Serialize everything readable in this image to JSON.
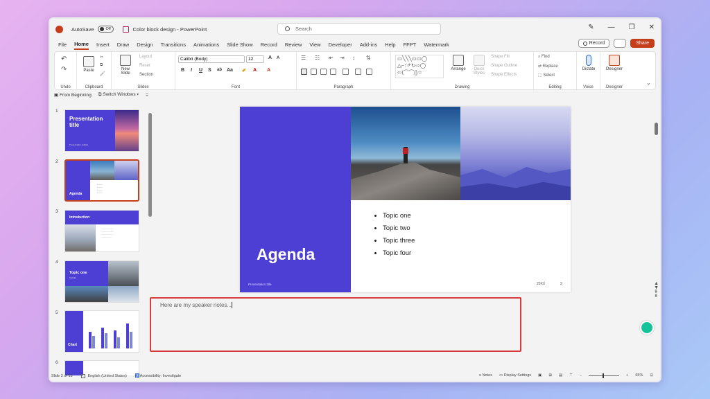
{
  "titlebar": {
    "autosave": "AutoSave",
    "toggle": "Off",
    "doc_title": "Color block design",
    "app": "PowerPoint",
    "search_placeholder": "Search"
  },
  "menu": {
    "items": [
      "File",
      "Home",
      "Insert",
      "Draw",
      "Design",
      "Transitions",
      "Animations",
      "Slide Show",
      "Record",
      "Review",
      "View",
      "Developer",
      "Add-ins",
      "Help",
      "FFPT",
      "Watermark"
    ],
    "active": "Home",
    "record": "Record",
    "share": "Share"
  },
  "ribbon": {
    "undo": "Undo",
    "clipboard": {
      "paste": "Paste",
      "label": "Clipboard"
    },
    "slides": {
      "new_slide": "New Slide",
      "layout": "Layout",
      "reset": "Reset",
      "section": "Section",
      "label": "Slides"
    },
    "font": {
      "name": "Calibri (Body)",
      "size": "12",
      "label": "Font"
    },
    "paragraph": {
      "label": "Paragraph"
    },
    "drawing": {
      "arrange": "Arrange",
      "quick_styles": "Quick Styles",
      "shape_fill": "Shape Fill",
      "shape_outline": "Shape Outline",
      "shape_effects": "Shape Effects",
      "label": "Drawing"
    },
    "editing": {
      "find": "Find",
      "replace": "Replace",
      "select": "Select",
      "label": "Editing"
    },
    "voice": {
      "dictate": "Dictate",
      "label": "Voice"
    },
    "designer": {
      "designer": "Designer",
      "label": "Designer"
    }
  },
  "quickbar": {
    "from_beginning": "From Beginning",
    "switch_windows": "Switch Windows"
  },
  "thumbnails": [
    {
      "num": "1",
      "title": "Presentation title",
      "sub": "Presentation subtitle"
    },
    {
      "num": "2",
      "title": "Agenda"
    },
    {
      "num": "3",
      "title": "Introduction"
    },
    {
      "num": "4",
      "title": "Topic one",
      "sub": "Subtitle"
    },
    {
      "num": "5",
      "title": "Chart"
    },
    {
      "num": "6"
    }
  ],
  "slide": {
    "title": "Agenda",
    "bullets": [
      "Topic one",
      "Topic two",
      "Topic three",
      "Topic four"
    ],
    "footer_left": "Presentation title",
    "footer_year": "20XX",
    "footer_page": "2"
  },
  "notes": {
    "text": "Here are my speaker notes..."
  },
  "status": {
    "slide_count": "Slide 2 of 13",
    "language": "English (United States)",
    "accessibility": "Accessibility: Investigate",
    "notes": "Notes",
    "display": "Display Settings",
    "zoom": "65%"
  },
  "colors": {
    "accent": "#c43e1c",
    "slide_purple": "#4d3fd3",
    "notes_border": "#d63a3a"
  }
}
